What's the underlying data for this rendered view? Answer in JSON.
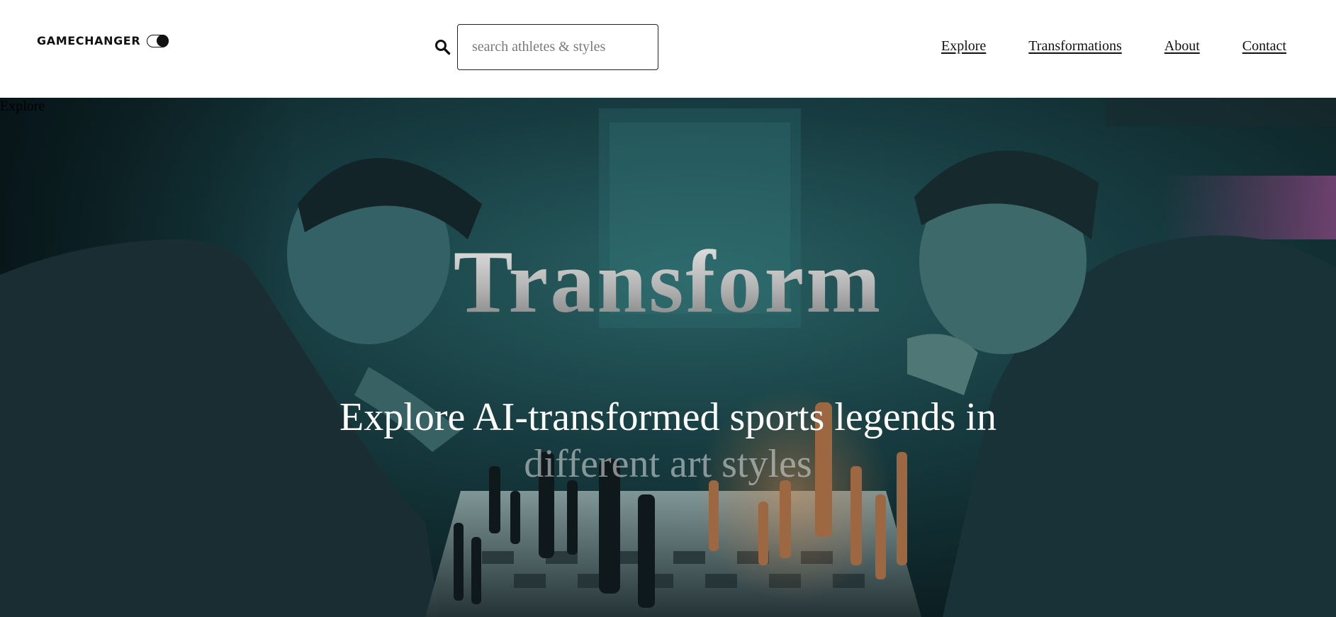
{
  "header": {
    "logo_text": "GAMECHANGER",
    "search": {
      "placeholder": "search athletes & styles",
      "value": ""
    },
    "nav": [
      {
        "label": "Explore"
      },
      {
        "label": "Transformations"
      },
      {
        "label": "About"
      },
      {
        "label": "Contact"
      }
    ]
  },
  "hero": {
    "section_label": "Explore",
    "title": "Transform",
    "subtitle_line1": "Explore AI-transformed sports legends in",
    "subtitle_line2": "different art styles"
  },
  "colors": {
    "header_background": "#ffffff",
    "text_dark": "#111111",
    "hero_teal": "#1e4f55",
    "hero_dark": "#0d2226",
    "accent_pink": "#c24b9e",
    "accent_orange": "#e08a4a"
  },
  "icons": [
    "theme-toggle-icon",
    "search-icon"
  ]
}
